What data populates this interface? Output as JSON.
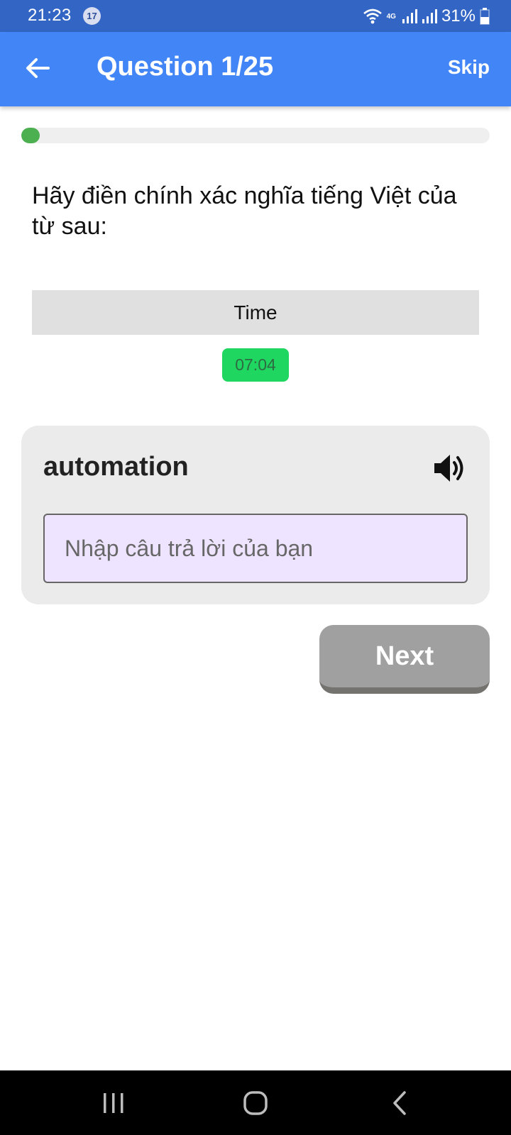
{
  "status_bar": {
    "time": "21:23",
    "notification_count": "17",
    "network": "4G",
    "battery": "31%"
  },
  "app_bar": {
    "back_icon": "arrow-left-icon",
    "title": "Question 1/25",
    "skip_label": "Skip"
  },
  "progress": {
    "current": 1,
    "total": 25,
    "fraction": 0.04
  },
  "question": {
    "prompt": "Hãy điền chính xác nghĩa tiếng Việt của từ sau:",
    "time_label": "Time",
    "timer": "07:04"
  },
  "card": {
    "word": "automation",
    "speaker_icon": "speaker-icon",
    "input_placeholder": "Nhập câu trả lời của bạn",
    "input_value": ""
  },
  "actions": {
    "next_label": "Next"
  },
  "nav_bar": {
    "recents_icon": "recents-icon",
    "home_icon": "home-icon",
    "back_icon": "nav-back-icon"
  },
  "colors": {
    "status_bar": "#3366c4",
    "app_bar": "#4285f7",
    "progress_fill": "#4caf50",
    "timer_chip": "#1fd760",
    "card_bg": "#ebebeb",
    "input_bg": "#eee4ff",
    "next_button": "#a0a0a0"
  }
}
